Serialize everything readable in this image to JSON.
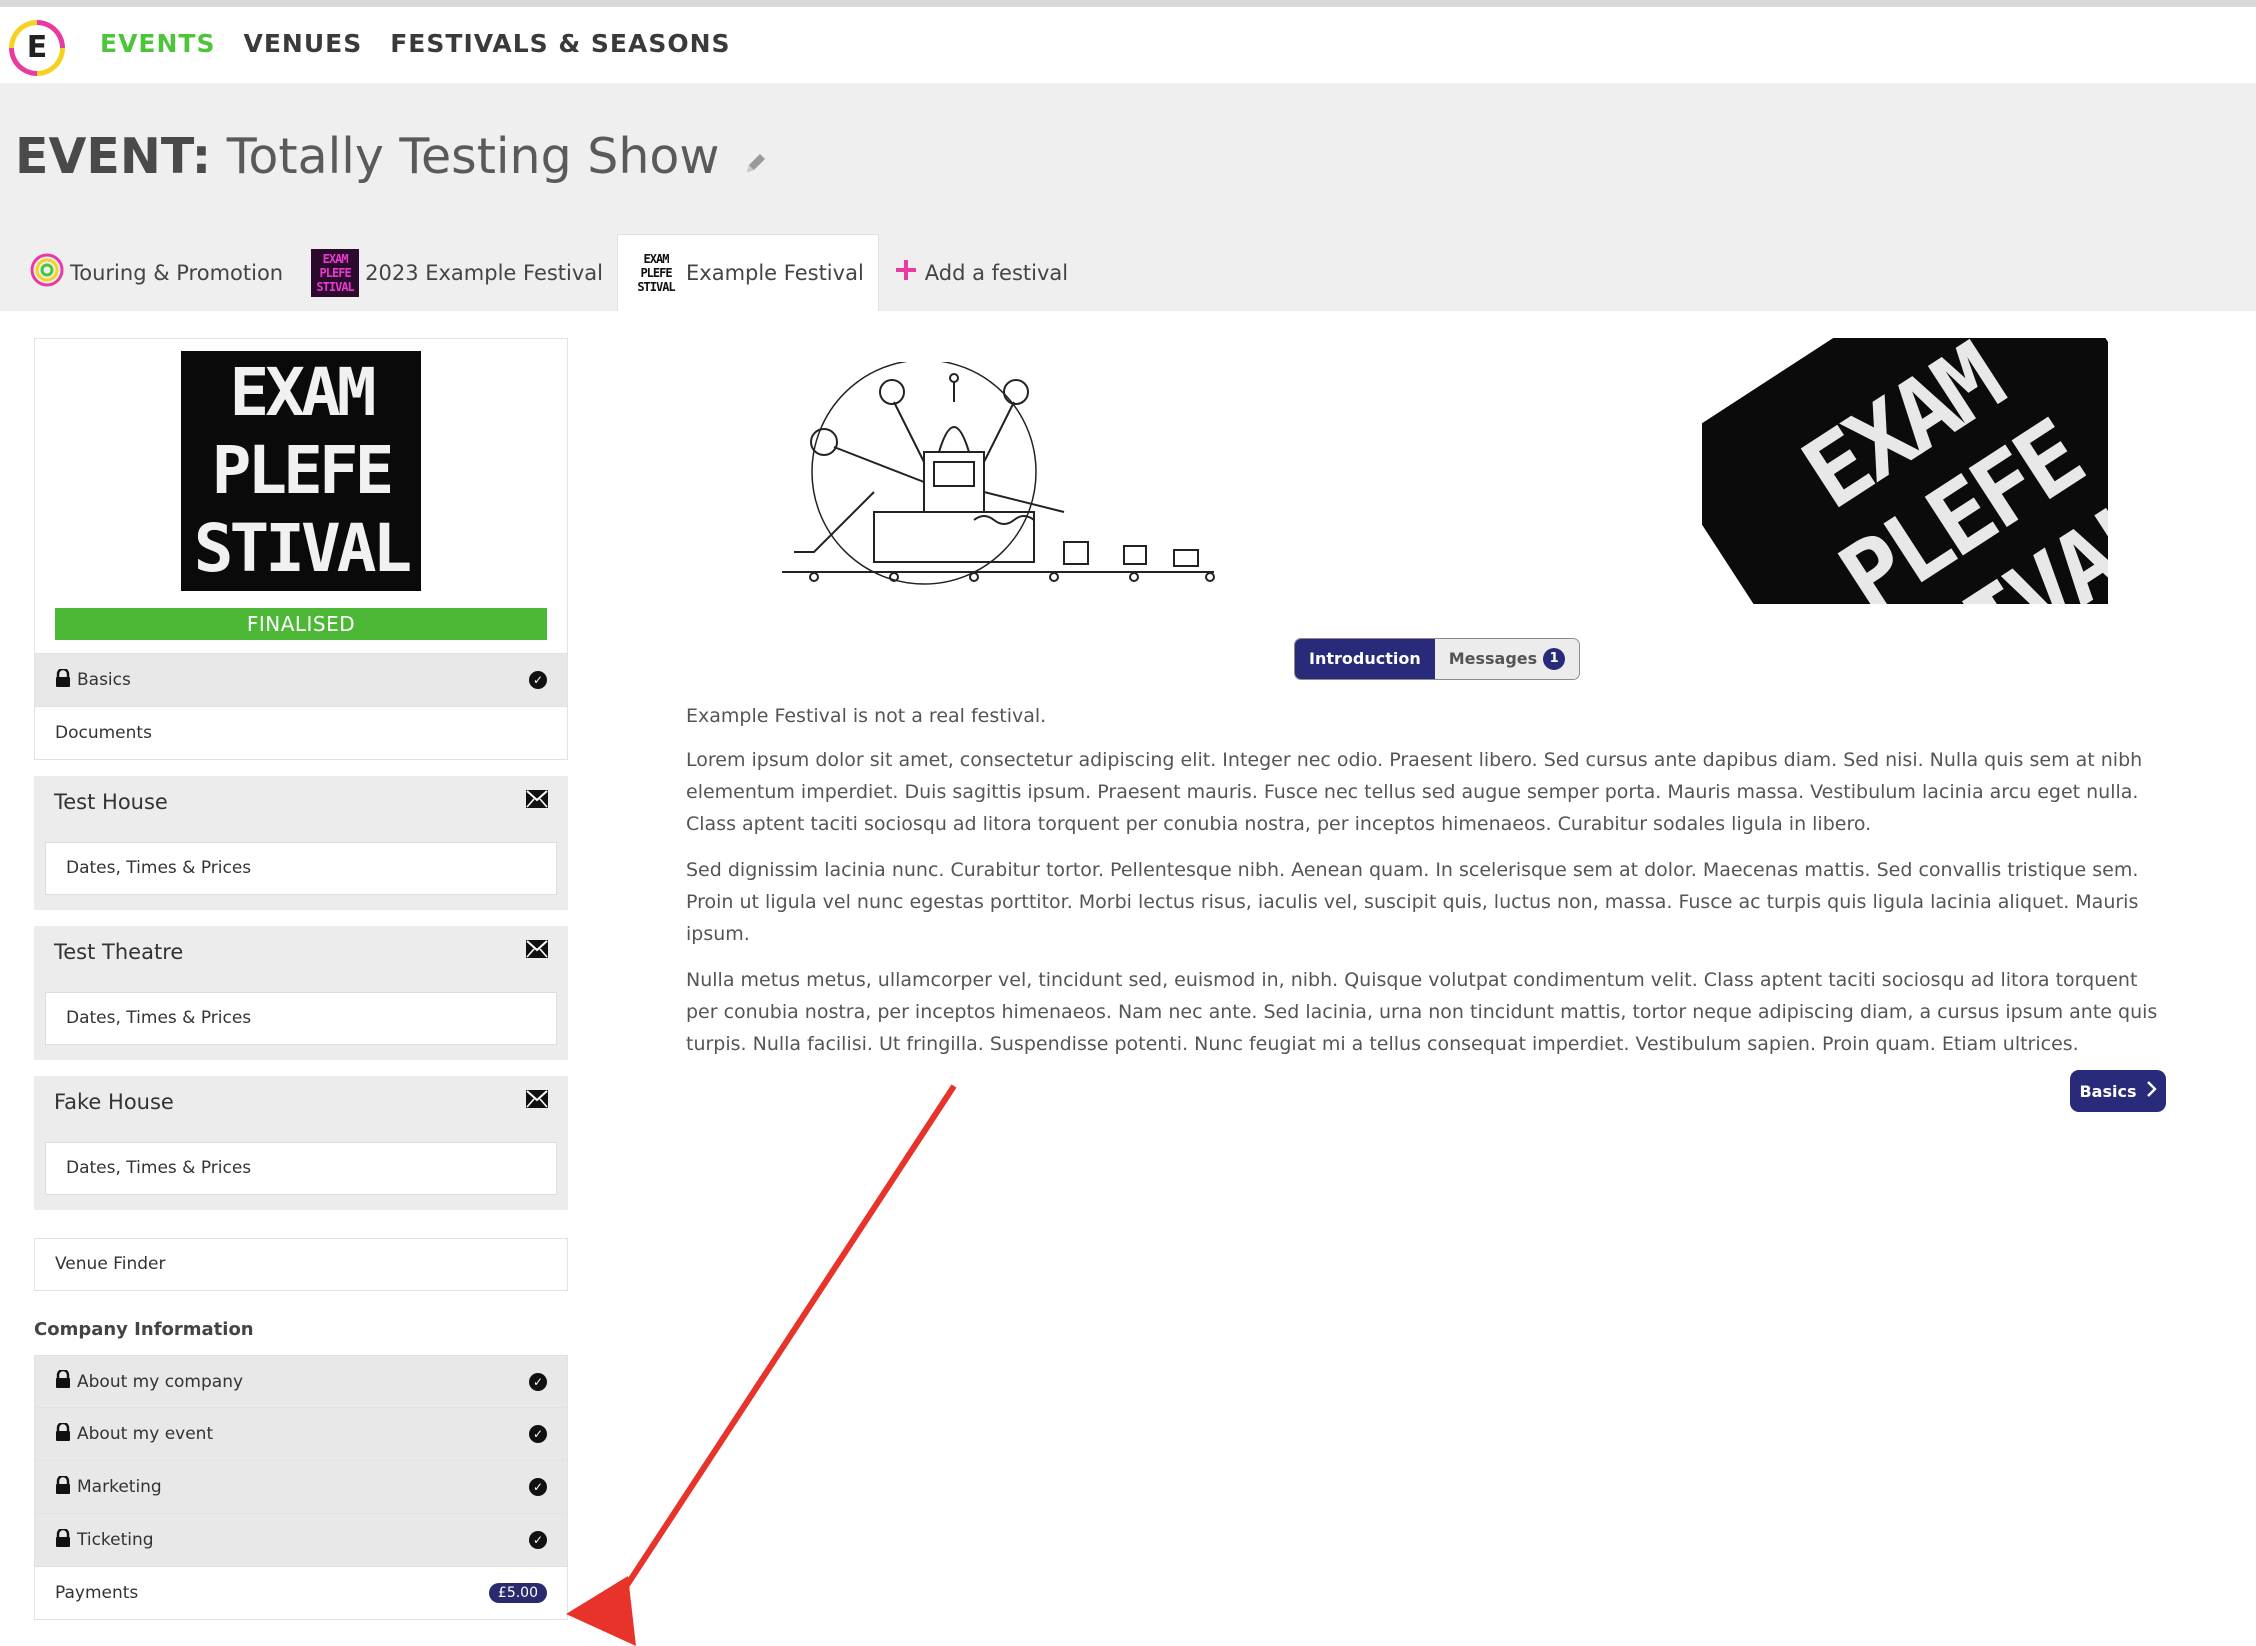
{
  "nav": {
    "logo_letter": "E",
    "links": [
      "EVENTS",
      "VENUES",
      "FESTIVALS & SEASONS"
    ]
  },
  "page": {
    "title_prefix": "EVENT:",
    "title": "Totally Testing Show"
  },
  "tabs": [
    {
      "label": "Touring & Promotion",
      "icon": "target-icon"
    },
    {
      "label": "2023 Example Festival",
      "icon": "festival-thumb-pink"
    },
    {
      "label": "Example Festival",
      "icon": "festival-thumb-bw",
      "active": true
    },
    {
      "label": "Add a festival",
      "icon": "plus-icon"
    }
  ],
  "festival_card": {
    "logo_lines": [
      "EXAM",
      "PLEFE",
      "STIVAL"
    ],
    "thumb_lines": [
      "EXAM",
      "PLEFE",
      "STIVAL"
    ],
    "status": "FINALISED",
    "status_color": "#4cb836"
  },
  "sidebar": {
    "basics": "Basics",
    "documents": "Documents",
    "venues": [
      {
        "name": "Test House",
        "sub": "Dates, Times & Prices"
      },
      {
        "name": "Test Theatre",
        "sub": "Dates, Times & Prices"
      },
      {
        "name": "Fake House",
        "sub": "Dates, Times & Prices"
      }
    ],
    "venue_finder": "Venue Finder",
    "company_heading": "Company Information",
    "company_items": [
      "About my company",
      "About my event",
      "Marketing",
      "Ticketing"
    ],
    "payments": "Payments",
    "payments_badge": "£5.00"
  },
  "main": {
    "tabs": {
      "introduction": "Introduction",
      "messages": "Messages",
      "messages_count": "1"
    },
    "intro_lead": "Example Festival is not a real festival.",
    "paragraphs": [
      "Lorem ipsum dolor sit amet, consectetur adipiscing elit. Integer nec odio. Praesent libero. Sed cursus ante dapibus diam. Sed nisi. Nulla quis sem at nibh elementum imperdiet. Duis sagittis ipsum. Praesent mauris. Fusce nec tellus sed augue semper porta. Mauris massa. Vestibulum lacinia arcu eget nulla. Class aptent taciti sociosqu ad litora torquent per conubia nostra, per inceptos himenaeos. Curabitur sodales ligula in libero.",
      "Sed dignissim lacinia nunc. Curabitur tortor. Pellentesque nibh. Aenean quam. In scelerisque sem at dolor. Maecenas mattis. Sed convallis tristique sem. Proin ut ligula vel nunc egestas porttitor. Morbi lectus risus, iaculis vel, suscipit quis, luctus non, massa. Fusce ac turpis quis ligula lacinia aliquet. Mauris ipsum.",
      "Nulla metus metus, ullamcorper vel, tincidunt sed, euismod in, nibh. Quisque volutpat condimentum velit. Class aptent taciti sociosqu ad litora torquent per conubia nostra, per inceptos himenaeos. Nam nec ante. Sed lacinia, urna non tincidunt mattis, tortor neque adipiscing diam, a cursus ipsum ante quis turpis. Nulla facilisi. Ut fringilla. Suspendisse potenti. Nunc feugiat mi a tellus consequat imperdiet. Vestibulum sapien. Proin quam. Etiam ultrices."
    ],
    "next_button": "Basics"
  },
  "colors": {
    "accent_green": "#4cc53a",
    "brand_navy": "#2a2a7a",
    "annotation_arrow": "#e8332a"
  }
}
